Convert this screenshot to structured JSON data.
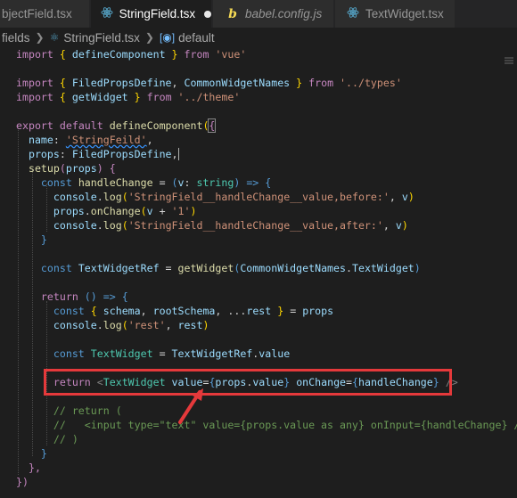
{
  "tabs": [
    {
      "label": "bjectField.tsx",
      "icon": "tsx-file-icon"
    },
    {
      "label": "StringField.tsx",
      "icon": "tsx-file-icon",
      "active": true,
      "unsaved": true
    },
    {
      "label": "babel.config.js",
      "icon": "babel-icon"
    },
    {
      "label": "TextWidget.tsx",
      "icon": "tsx-file-icon"
    }
  ],
  "breadcrumb": {
    "folder": "fields",
    "file": "StringField.tsx",
    "symbol": "default"
  },
  "code": {
    "l1a": "import",
    "l1b": "{",
    "l1c": "defineComponent",
    "l1d": "}",
    "l1e": "from",
    "l1f": "'vue'",
    "l3a": "import",
    "l3b": "{",
    "l3c": "FiledPropsDefine",
    "l3d": ",",
    "l3e": "CommonWidgetNames",
    "l3f": "}",
    "l3g": "from",
    "l3h": "'../types'",
    "l4a": "import",
    "l4b": "{",
    "l4c": "getWidget",
    "l4d": "}",
    "l4e": "from",
    "l4f": "'../theme'",
    "l6a": "export",
    "l6b": "default",
    "l6c": "defineComponent",
    "l6d": "(",
    "l6e": "{",
    "l7a": "name",
    "l7b": ":",
    "l7c": "'StringFeild'",
    "l7d": ",",
    "l8a": "props",
    "l8b": ":",
    "l8c": "FiledPropsDefine",
    "l8d": ",",
    "l9a": "setup",
    "l9b": "(",
    "l9c": "props",
    "l9d": ")",
    "l9e": "{",
    "l10a": "const",
    "l10b": "handleChange",
    "l10c": "=",
    "l10d": "(",
    "l10e": "v",
    "l10f": ":",
    "l10g": "string",
    "l10h": ")",
    "l10i": "=>",
    "l10j": "{",
    "l11a": "console",
    "l11b": ".",
    "l11c": "log",
    "l11d": "(",
    "l11e": "'StringField__handleChange__value,before:'",
    "l11f": ",",
    "l11g": "v",
    "l11h": ")",
    "l12a": "props",
    "l12b": ".",
    "l12c": "onChange",
    "l12d": "(",
    "l12e": "v",
    "l12f": "+",
    "l12g": "'1'",
    "l12h": ")",
    "l13a": "console",
    "l13b": ".",
    "l13c": "log",
    "l13d": "(",
    "l13e": "'StringField__handleChange__value,after:'",
    "l13f": ",",
    "l13g": "v",
    "l13h": ")",
    "l14a": "}",
    "l16a": "const",
    "l16b": "TextWidgetRef",
    "l16c": "=",
    "l16d": "getWidget",
    "l16e": "(",
    "l16f": "CommonWidgetNames",
    "l16g": ".",
    "l16h": "TextWidget",
    "l16i": ")",
    "l18a": "return",
    "l18b": "()",
    "l18c": "=>",
    "l18d": "{",
    "l19a": "const",
    "l19b": "{",
    "l19c": "schema",
    "l19d": ",",
    "l19e": "rootSchema",
    "l19f": ",",
    "l19g": "...",
    "l19h": "rest",
    "l19i": "}",
    "l19j": "=",
    "l19k": "props",
    "l20a": "console",
    "l20b": ".",
    "l20c": "log",
    "l20d": "(",
    "l20e": "'rest'",
    "l20f": ",",
    "l20g": "rest",
    "l20h": ")",
    "l22a": "const",
    "l22b": "TextWidget",
    "l22c": "=",
    "l22d": "TextWidgetRef",
    "l22e": ".",
    "l22f": "value",
    "l24a": "return",
    "l24b": "<",
    "l24c": "TextWidget",
    "l24d": "value",
    "l24e": "=",
    "l24f": "{",
    "l24g": "props",
    "l24h": ".",
    "l24i": "value",
    "l24j": "}",
    "l24k": "onChange",
    "l24l": "=",
    "l24m": "{",
    "l24n": "handleChange",
    "l24o": "}",
    "l24p": "/>",
    "l26a": "// return (",
    "l27a": "//   <input type=\"text\" value={props.value as any} onInput={handleChange} />",
    "l28a": "// )",
    "l29a": "}",
    "l30a": "},",
    "l31a": "})"
  },
  "colors": {
    "highlight_box": "#e5393b",
    "arrow": "#e5393b"
  }
}
